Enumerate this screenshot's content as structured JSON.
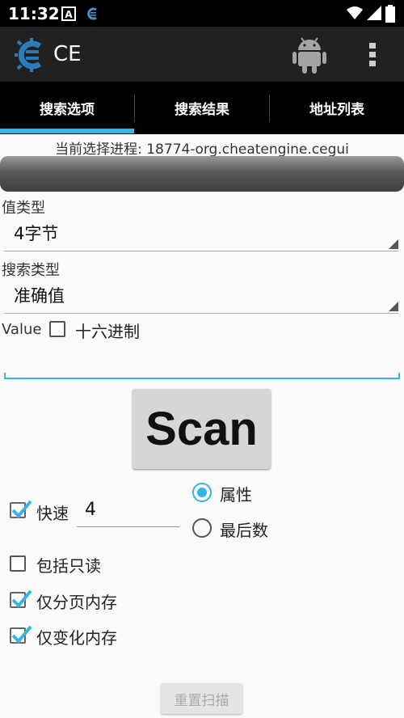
{
  "status_bar": {
    "time": "11:32"
  },
  "app_bar": {
    "title": "CE"
  },
  "tabs": [
    {
      "label": "搜索选项"
    },
    {
      "label": "搜索结果"
    },
    {
      "label": "地址列表"
    }
  ],
  "process": {
    "label": "当前选择进程: 18774-org.cheatengine.cegui"
  },
  "value_type": {
    "label": "值类型",
    "selected": "4字节"
  },
  "scan_type": {
    "label": "搜索类型",
    "selected": "准确值"
  },
  "value_row": {
    "label": "Value",
    "hex_label": "十六进制",
    "hex_checked": false
  },
  "value_input": {
    "value": ""
  },
  "scan_button": {
    "label": "Scan"
  },
  "options": {
    "fast": {
      "label": "快速",
      "checked": true,
      "value": "4"
    },
    "alignment": {
      "label": "属性",
      "selected": true
    },
    "last_digits": {
      "label": "最后数",
      "selected": false
    },
    "include_readonly": {
      "label": "包括只读",
      "checked": false
    },
    "paged_only": {
      "label": "仅分页内存",
      "checked": true
    },
    "changed_only": {
      "label": "仅变化内存",
      "checked": true
    }
  },
  "reset_button": {
    "label": "重置扫描"
  },
  "colors": {
    "accent": "#33b5e5",
    "logo": "#2a7db8",
    "android": "#a4a4a4"
  }
}
